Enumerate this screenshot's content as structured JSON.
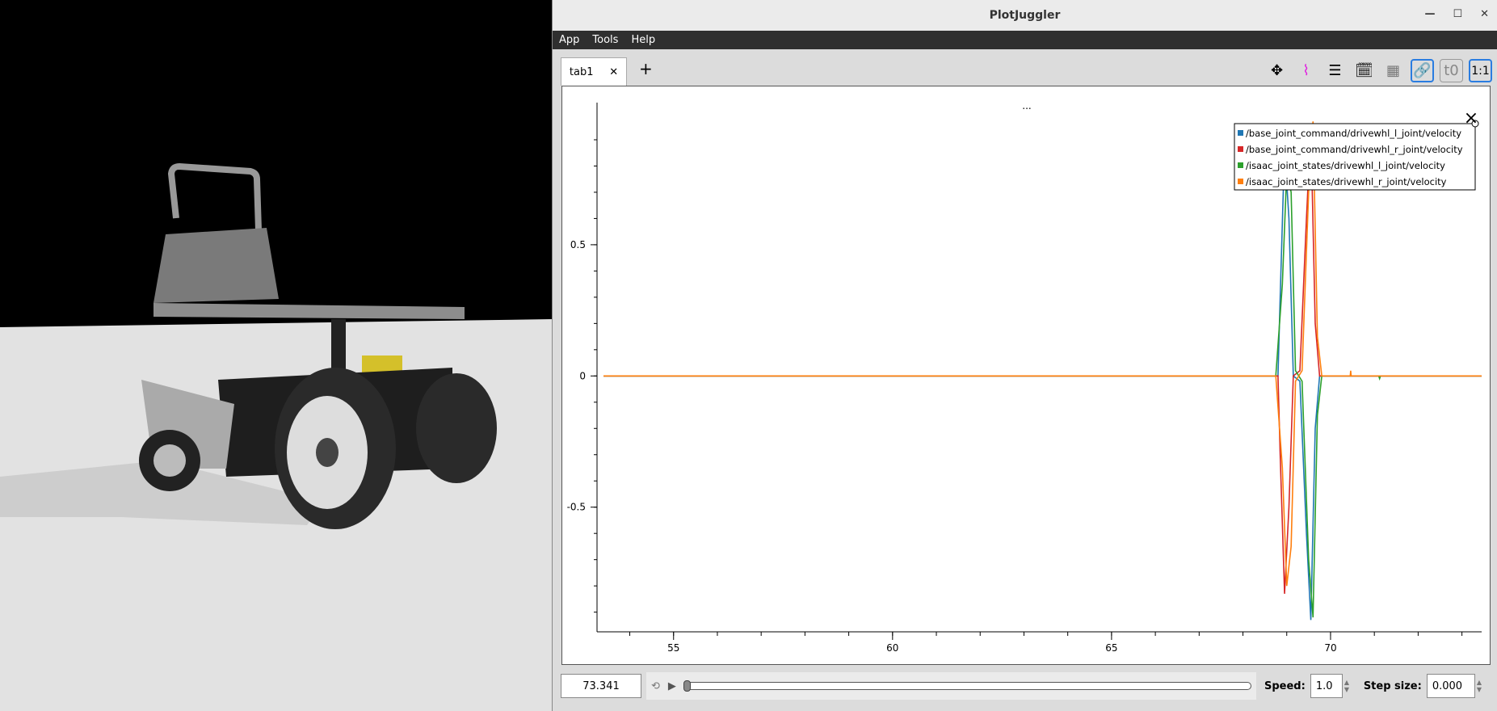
{
  "window": {
    "title": "PlotJuggler"
  },
  "menu": [
    "App",
    "Tools",
    "Help"
  ],
  "tabs": [
    {
      "label": "tab1"
    }
  ],
  "toolbar": {
    "t0_label": "t0",
    "ratio_label": "1:1"
  },
  "plot": {
    "title": "..."
  },
  "bottom": {
    "time": "73.341",
    "speed_label": "Speed:",
    "speed": "1.0",
    "step_label": "Step size:",
    "step": "0.000",
    "progress": 0.0
  },
  "chart_data": {
    "type": "line",
    "xlim": [
      53.4,
      73.45
    ],
    "ylim": [
      -0.975,
      0.98
    ],
    "xticks": [
      55,
      60,
      65,
      70
    ],
    "yticks": [
      0.5,
      0,
      -0.5
    ],
    "series": [
      {
        "name": "/base_joint_command/drivewhl_l_joint/velocity",
        "color": "#1f77b4",
        "x": [
          53.4,
          68.8,
          68.85,
          68.95,
          69.05,
          69.15,
          69.3,
          69.45,
          69.55,
          69.65,
          69.75,
          73.45
        ],
        "y": [
          0,
          0,
          0.3,
          0.87,
          0.6,
          0,
          -0.02,
          -0.6,
          -0.93,
          -0.2,
          0,
          0
        ]
      },
      {
        "name": "/base_joint_command/drivewhl_r_joint/velocity",
        "color": "#d62728",
        "x": [
          53.4,
          68.8,
          68.85,
          68.95,
          69.05,
          69.15,
          69.3,
          69.45,
          69.55,
          69.65,
          69.75,
          73.45
        ],
        "y": [
          0,
          0,
          -0.3,
          -0.83,
          -0.5,
          0,
          0.02,
          0.6,
          0.95,
          0.2,
          0,
          0
        ]
      },
      {
        "name": "/isaac_joint_states/drivewhl_l_joint/velocity",
        "color": "#2ca02c",
        "x": [
          53.4,
          68.75,
          68.9,
          69.0,
          69.1,
          69.2,
          69.35,
          69.5,
          69.6,
          69.7,
          69.8,
          71.1,
          71.12,
          71.14,
          73.45
        ],
        "y": [
          0,
          0,
          0.35,
          0.78,
          0.7,
          0.02,
          -0.02,
          -0.7,
          -0.92,
          -0.15,
          0,
          0,
          -0.01,
          0,
          0
        ]
      },
      {
        "name": "/isaac_joint_states/drivewhl_r_joint/velocity",
        "color": "#ff7f0e",
        "x": [
          53.4,
          68.75,
          68.9,
          69.0,
          69.1,
          69.2,
          69.35,
          69.5,
          69.6,
          69.7,
          69.8,
          70.45,
          70.46,
          70.47,
          73.45
        ],
        "y": [
          0,
          0,
          -0.35,
          -0.8,
          -0.65,
          -0.02,
          0.02,
          0.7,
          0.97,
          0.15,
          0,
          0,
          0.02,
          0,
          0
        ]
      }
    ]
  }
}
